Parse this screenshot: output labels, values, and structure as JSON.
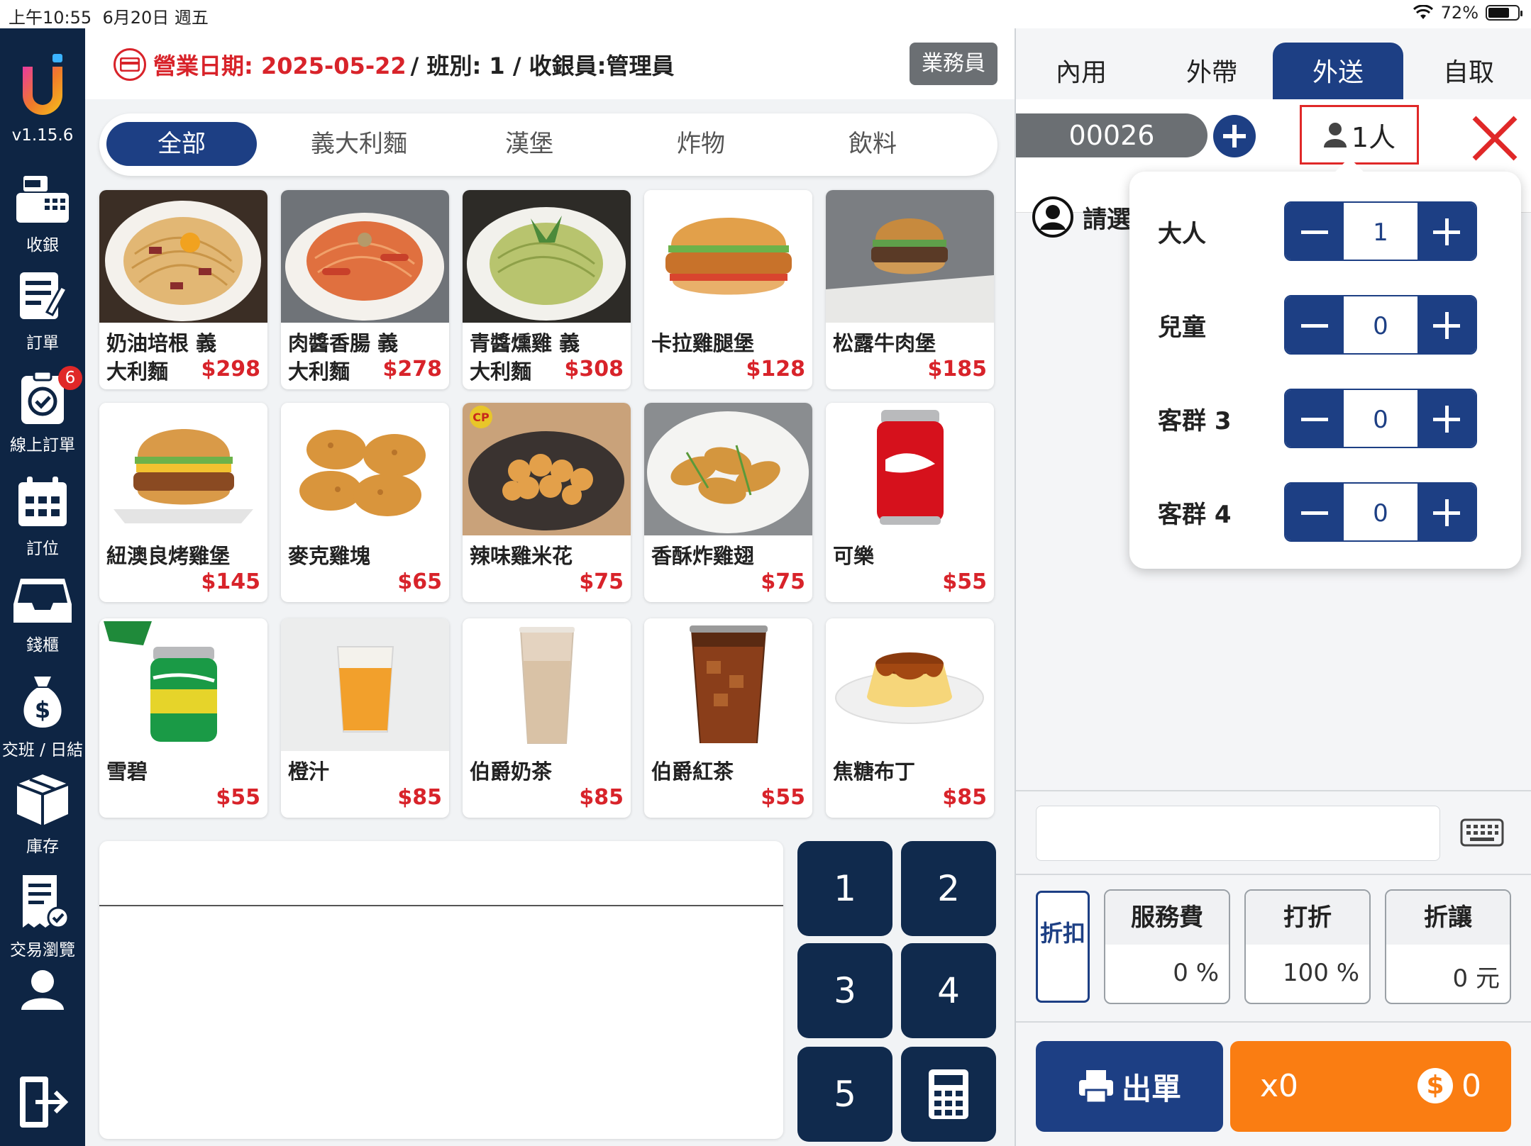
{
  "status_bar": {
    "time": "上午10:55",
    "date": "6月20日 週五",
    "battery": "72%",
    "battery_level": 0.72
  },
  "sidebar": {
    "version": "v1.15.6",
    "items": [
      {
        "label": "收銀",
        "icon": "cash-register-icon"
      },
      {
        "label": "訂單",
        "icon": "order-icon"
      },
      {
        "label": "線上訂單",
        "icon": "online-order-icon",
        "badge": "6"
      },
      {
        "label": "訂位",
        "icon": "calendar-icon"
      },
      {
        "label": "錢櫃",
        "icon": "drawer-icon"
      },
      {
        "label": "交班 / 日結",
        "icon": "money-bag-icon"
      },
      {
        "label": "庫存",
        "icon": "box-icon"
      },
      {
        "label": "交易瀏覽",
        "icon": "receipt-icon"
      },
      {
        "label": "",
        "icon": "user-icon"
      },
      {
        "label": "",
        "icon": "logout-icon"
      }
    ]
  },
  "header": {
    "date_label": "營業日期: 2025-05-22",
    "shift_info": "/ 班別: 1 / 收銀員:管理員",
    "salesman_button": "業務員"
  },
  "categories": [
    "全部",
    "義大利麵",
    "漢堡",
    "炸物",
    "飲料"
  ],
  "products": [
    {
      "name": "奶油培根 義大利麵",
      "price": "$298"
    },
    {
      "name": "肉醬香腸 義大利麵",
      "price": "$278"
    },
    {
      "name": "青醬燻雞 義大利麵",
      "price": "$308"
    },
    {
      "name": "卡拉雞腿堡",
      "price": "$128"
    },
    {
      "name": "松露牛肉堡",
      "price": "$185"
    },
    {
      "name": "紐澳良烤雞堡",
      "price": "$145"
    },
    {
      "name": "麥克雞塊",
      "price": "$65"
    },
    {
      "name": "辣味雞米花",
      "price": "$75"
    },
    {
      "name": "香酥炸雞翅",
      "price": "$75"
    },
    {
      "name": "可樂",
      "price": "$55"
    },
    {
      "name": "雪碧",
      "price": "$55"
    },
    {
      "name": "橙汁",
      "price": "$85"
    },
    {
      "name": "伯爵奶茶",
      "price": "$85"
    },
    {
      "name": "伯爵紅茶",
      "price": "$55"
    },
    {
      "name": "焦糖布丁",
      "price": "$85"
    }
  ],
  "numpad": [
    "1",
    "2",
    "3",
    "4",
    "5"
  ],
  "order_types": [
    "內用",
    "外帶",
    "外送",
    "自取"
  ],
  "order": {
    "number": "00026",
    "people": "1人",
    "customer_placeholder": "請選"
  },
  "guest_popup": {
    "rows": [
      {
        "label": "大人",
        "value": "1"
      },
      {
        "label": "兒童",
        "value": "0"
      },
      {
        "label": "客群 3",
        "value": "0"
      },
      {
        "label": "客群 4",
        "value": "0"
      }
    ]
  },
  "discount": {
    "tag": "折扣",
    "fees": [
      {
        "title": "服務費",
        "value": "0 %"
      },
      {
        "title": "打折",
        "value": "100 %"
      },
      {
        "title": "折讓",
        "value": "0 元"
      }
    ]
  },
  "actions": {
    "print_label": "出單",
    "count": "x0",
    "currency_symbol": "$",
    "total": "0"
  },
  "colors": {
    "primary": "#1d3f84",
    "sidebar": "#0e2544",
    "accent": "#fa7d12",
    "price": "#d8232a"
  }
}
